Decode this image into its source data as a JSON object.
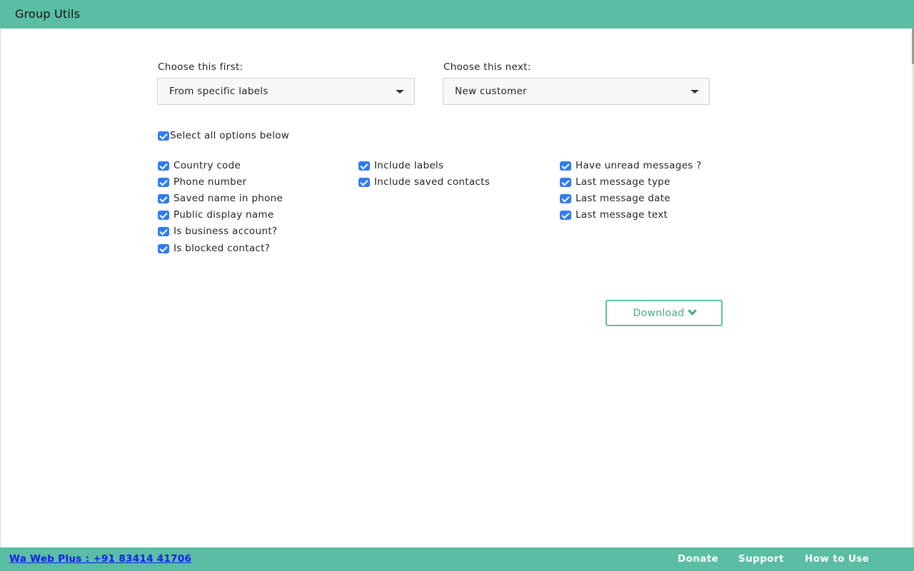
{
  "header": {
    "title": "Group Utils"
  },
  "selectors": {
    "first": {
      "label": "Choose this first:",
      "value": "From specific labels"
    },
    "next": {
      "label": "Choose this next:",
      "value": "New customer"
    }
  },
  "select_all": {
    "label": "Select all options below",
    "checked": true
  },
  "options": {
    "col1": [
      {
        "label": "Country code",
        "checked": true
      },
      {
        "label": "Phone number",
        "checked": true
      },
      {
        "label": "Saved name in phone",
        "checked": true
      },
      {
        "label": "Public display name",
        "checked": true
      },
      {
        "label": "Is business account?",
        "checked": true
      },
      {
        "label": "Is blocked contact?",
        "checked": true
      }
    ],
    "col2": [
      {
        "label": "Include labels",
        "checked": true
      },
      {
        "label": "Include saved contacts",
        "checked": true
      }
    ],
    "col3": [
      {
        "label": "Have unread messages ?",
        "checked": true
      },
      {
        "label": "Last message type",
        "checked": true
      },
      {
        "label": "Last message date",
        "checked": true
      },
      {
        "label": "Last message text",
        "checked": true
      }
    ]
  },
  "download": {
    "label": "Download",
    "icon": "chevron-down-icon"
  },
  "footer": {
    "contact": "Wa Web Plus : +91 83414 41706",
    "links": [
      "Donate",
      "Support",
      "How to Use"
    ]
  },
  "colors": {
    "accent": "#59bea3",
    "checkbox": "#2f7bf5",
    "link": "#1a1aee"
  }
}
